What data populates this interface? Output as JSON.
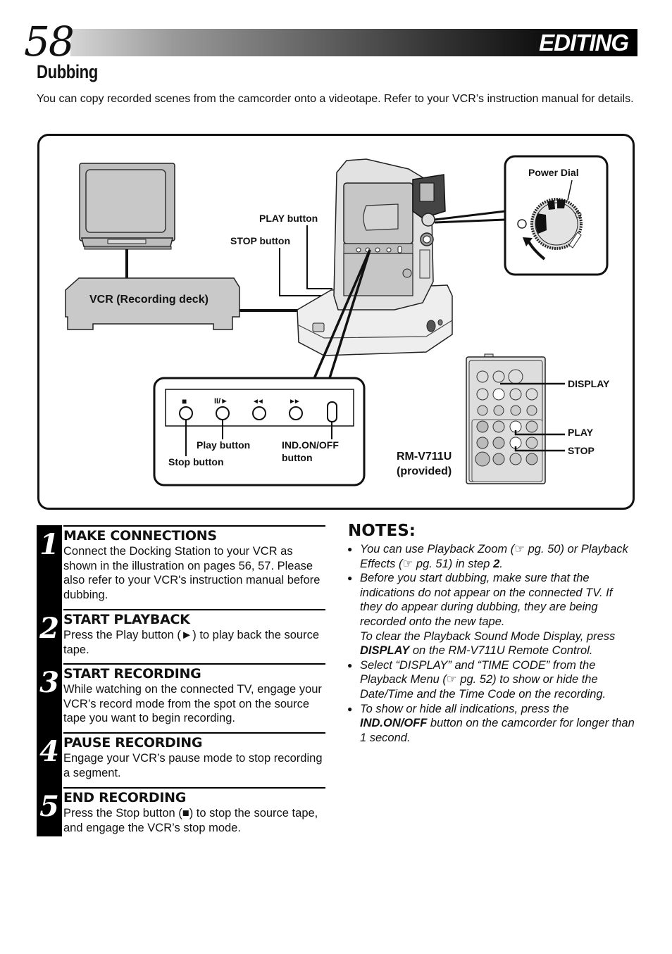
{
  "header": {
    "page_number": "58",
    "section": "EDITING"
  },
  "heading": "Dubbing",
  "intro": "You can copy recorded scenes from the camcorder onto a videotape. Refer to your VCR’s instruction manual for details.",
  "diagram": {
    "vcr_label": "VCR (Recording deck)",
    "dock_play_label": "PLAY button",
    "dock_stop_label": "STOP button",
    "power_dial_label": "Power Dial",
    "panel": {
      "buttons": [
        {
          "name": "stop",
          "glyph": "■"
        },
        {
          "name": "play-pause",
          "glyph": "II/►"
        },
        {
          "name": "rewind",
          "glyph": "◄◄"
        },
        {
          "name": "fast-forward",
          "glyph": "►►"
        },
        {
          "name": "ind-on-off",
          "glyph": ""
        }
      ],
      "play_label": "Play button",
      "stop_label": "Stop button",
      "ind_label_1": "IND.ON/OFF",
      "ind_label_2": "button"
    },
    "remote": {
      "model": "RM-V711U",
      "provided": "(provided)",
      "display_label": "DISPLAY",
      "play_label": "PLAY",
      "stop_label": "STOP"
    }
  },
  "steps": [
    {
      "num": "1",
      "title": "MAKE CONNECTIONS",
      "body": "Connect the Docking Station to your VCR as shown in the illustration on pages 56, 57. Please also refer to your VCR's instruction manual before dubbing."
    },
    {
      "num": "2",
      "title": "START PLAYBACK",
      "body": "Press the Play button (►) to play back the source tape."
    },
    {
      "num": "3",
      "title": "START RECORDING",
      "body": "While watching on the connected TV, engage your VCR’s record mode from the spot on the source tape you want to begin recording."
    },
    {
      "num": "4",
      "title": "PAUSE RECORDING",
      "body": "Engage your VCR’s pause mode to stop recording a segment."
    },
    {
      "num": "5",
      "title": "END RECORDING",
      "body": "Press the Stop button (■) to stop the source tape, and engage the VCR’s stop mode."
    }
  ],
  "notes": {
    "title": "NOTES:",
    "ref_icon": "☞",
    "items": [
      {
        "a": "You can use Playback Zoom (",
        "ref1": "pg. 50) or Playback Effects (",
        "ref2": "pg. 51) in step ",
        "bold": "2",
        "end": "."
      },
      {
        "a": "Before you start dubbing, make sure that the indications do not appear on the connected TV. If they do appear during dubbing, they are being recorded onto the new tape.",
        "sub_a": "To clear the Playback Sound Mode Display, press ",
        "bold": "DISPLAY",
        "end": " on the RM-V711U Remote Control."
      },
      {
        "a": "Select “DISPLAY” and “TIME CODE” from the Playback Menu (",
        "ref1": "pg. 52) to show or hide the Date/Time and the Time Code on the recording."
      },
      {
        "a": "To show or hide all indications, press the ",
        "bold": "IND.ON/OFF",
        "end": " button on the camcorder for longer than 1 second."
      }
    ]
  }
}
